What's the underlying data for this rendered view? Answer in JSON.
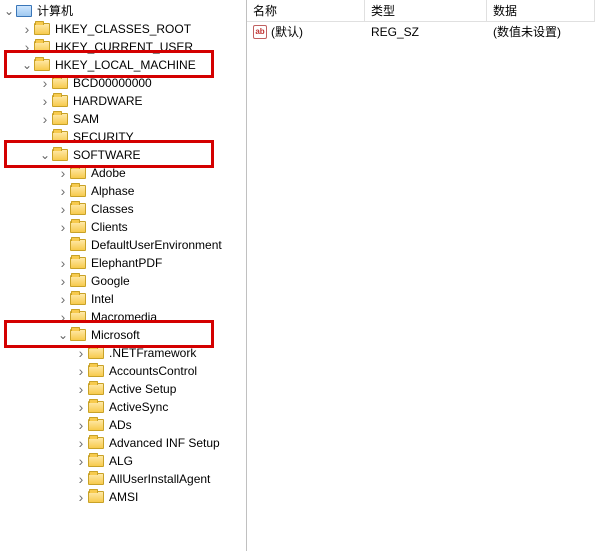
{
  "list": {
    "headers": {
      "name": "名称",
      "type": "类型",
      "data": "数据"
    },
    "rows": [
      {
        "name": "(默认)",
        "type": "REG_SZ",
        "data": "(数值未设置)"
      }
    ]
  },
  "tree": {
    "root": "计算机",
    "nodes": [
      {
        "label": "HKEY_CLASSES_ROOT",
        "depth": 1,
        "arrow": "closed"
      },
      {
        "label": "HKEY_CURRENT_USER",
        "depth": 1,
        "arrow": "closed"
      },
      {
        "label": "HKEY_LOCAL_MACHINE",
        "depth": 1,
        "arrow": "open",
        "highlight": true
      },
      {
        "label": "BCD00000000",
        "depth": 2,
        "arrow": "closed"
      },
      {
        "label": "HARDWARE",
        "depth": 2,
        "arrow": "closed"
      },
      {
        "label": "SAM",
        "depth": 2,
        "arrow": "closed"
      },
      {
        "label": "SECURITY",
        "depth": 2,
        "arrow": "none"
      },
      {
        "label": "SOFTWARE",
        "depth": 2,
        "arrow": "open",
        "highlight": true
      },
      {
        "label": "Adobe",
        "depth": 3,
        "arrow": "closed"
      },
      {
        "label": "Alphase",
        "depth": 3,
        "arrow": "closed"
      },
      {
        "label": "Classes",
        "depth": 3,
        "arrow": "closed"
      },
      {
        "label": "Clients",
        "depth": 3,
        "arrow": "closed"
      },
      {
        "label": "DefaultUserEnvironment",
        "depth": 3,
        "arrow": "none"
      },
      {
        "label": "ElephantPDF",
        "depth": 3,
        "arrow": "closed"
      },
      {
        "label": "Google",
        "depth": 3,
        "arrow": "closed"
      },
      {
        "label": "Intel",
        "depth": 3,
        "arrow": "closed"
      },
      {
        "label": "Macromedia",
        "depth": 3,
        "arrow": "closed"
      },
      {
        "label": "Microsoft",
        "depth": 3,
        "arrow": "open",
        "highlight": true
      },
      {
        "label": ".NETFramework",
        "depth": 4,
        "arrow": "closed"
      },
      {
        "label": "AccountsControl",
        "depth": 4,
        "arrow": "closed"
      },
      {
        "label": "Active Setup",
        "depth": 4,
        "arrow": "closed"
      },
      {
        "label": "ActiveSync",
        "depth": 4,
        "arrow": "closed"
      },
      {
        "label": "ADs",
        "depth": 4,
        "arrow": "closed"
      },
      {
        "label": "Advanced INF Setup",
        "depth": 4,
        "arrow": "closed"
      },
      {
        "label": "ALG",
        "depth": 4,
        "arrow": "closed"
      },
      {
        "label": "AllUserInstallAgent",
        "depth": 4,
        "arrow": "closed"
      },
      {
        "label": "AMSI",
        "depth": 4,
        "arrow": "closed"
      }
    ]
  }
}
